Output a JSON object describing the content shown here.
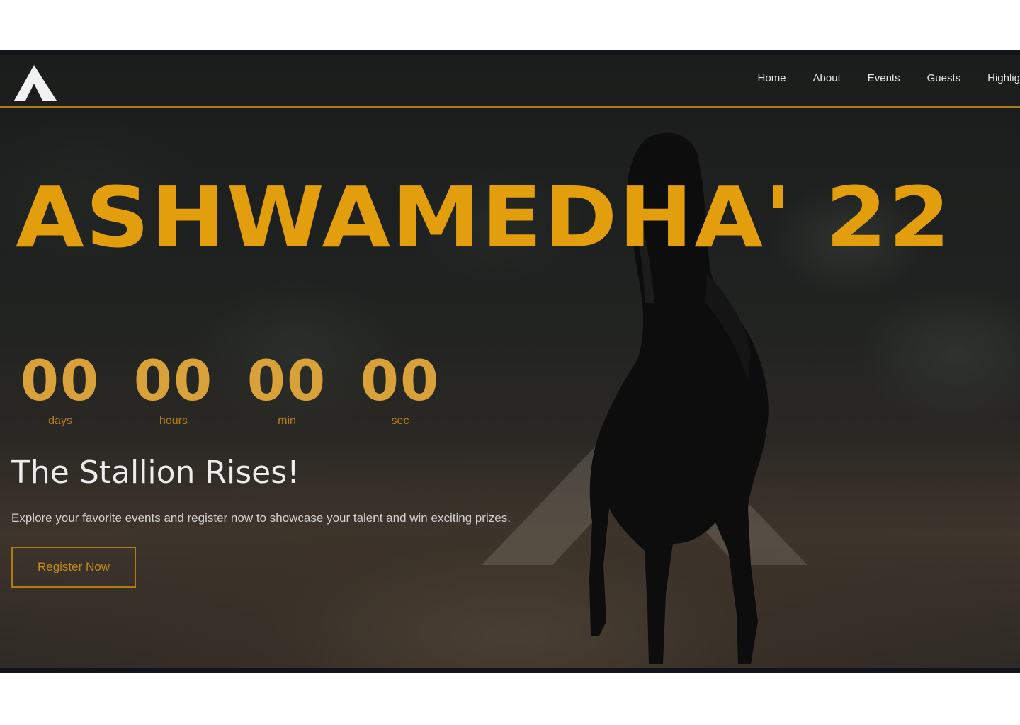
{
  "nav": {
    "logo_alt": "A",
    "links": [
      {
        "label": "Home"
      },
      {
        "label": "About"
      },
      {
        "label": "Events"
      },
      {
        "label": "Guests"
      },
      {
        "label": "Highlights"
      }
    ]
  },
  "hero": {
    "title": "ASHWAMEDHA' 22",
    "countdown": [
      {
        "value": "00",
        "label": "days"
      },
      {
        "value": "00",
        "label": "hours"
      },
      {
        "value": "00",
        "label": "min"
      },
      {
        "value": "00",
        "label": "sec"
      }
    ],
    "tagline": "The Stallion Rises!",
    "description": "Explore your favorite events and register now to showcase your talent and win exciting prizes.",
    "cta_label": "Register Now"
  },
  "colors": {
    "accent": "#e39e0e",
    "accent_dark": "#b07a18",
    "background": "#11151b",
    "text": "#ececec"
  },
  "icons": {
    "logo": "ashwamedha-a-logo-icon",
    "background_mark": "triangle-watermark-icon"
  }
}
